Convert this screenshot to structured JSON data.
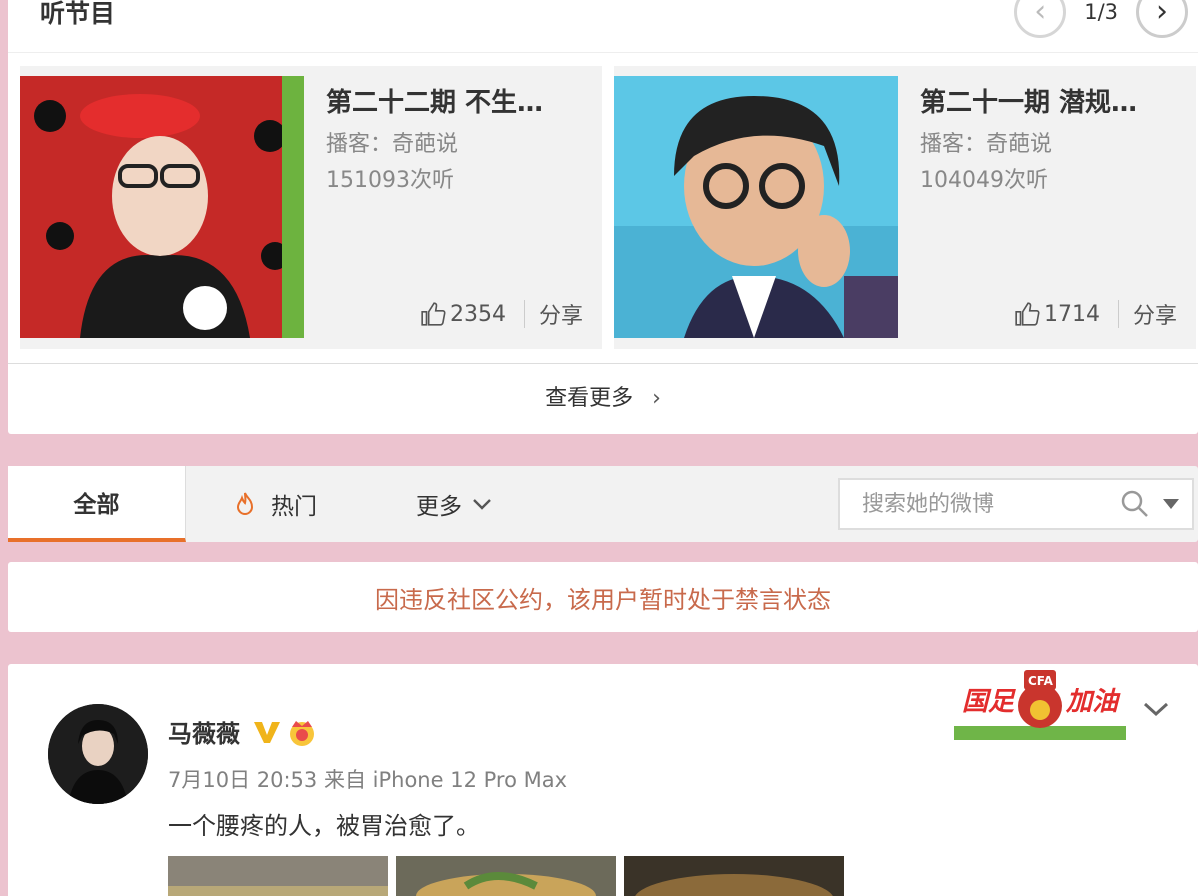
{
  "podcast": {
    "title": "听节目",
    "page": "1/3",
    "episodes": [
      {
        "title": "第二十二期 不生…",
        "host": "播客：奇葩说",
        "plays": "151093次听",
        "likes": "2354",
        "share": "分享"
      },
      {
        "title": "第二十一期 潜规…",
        "host": "播客：奇葩说",
        "plays": "104049次听",
        "likes": "1714",
        "share": "分享"
      }
    ],
    "see_more": "查看更多"
  },
  "tabs": {
    "all": "全部",
    "hot": "热门",
    "more": "更多",
    "search_placeholder": "搜索她的微博"
  },
  "notice": "因违反社区公约，该用户暂时处于禁言状态",
  "post": {
    "author": "马薇薇",
    "timestamp": "7月10日 20:53",
    "source": "来自 iPhone 12 Pro Max",
    "text": "一个腰疼的人，被胃治愈了。",
    "banner_text": "国足加油",
    "banner_badge": "CFA"
  },
  "colors": {
    "page_background": "#ecc3cf",
    "accent_orange": "#e8702a",
    "notice_text": "#c86a4c",
    "verified_gold": "#f0b41a"
  }
}
